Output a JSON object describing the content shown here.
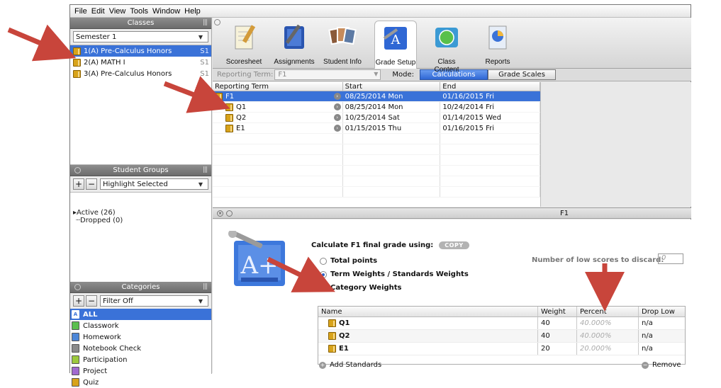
{
  "menu": [
    "File",
    "Edit",
    "View",
    "Tools",
    "Window",
    "Help"
  ],
  "classes": {
    "header": "Classes",
    "semester": "Semester 1",
    "items": [
      {
        "name": "1(A) Pre-Calculus Honors",
        "tail": "S1",
        "selected": true
      },
      {
        "name": "2(A) MATH I",
        "tail": "S1",
        "selected": false
      },
      {
        "name": "3(A) Pre-Calculus Honors",
        "tail": "S1",
        "selected": false
      }
    ]
  },
  "student_groups": {
    "header": "Student Groups",
    "filter": "Highlight Selected",
    "tree": [
      "Active (26)",
      "Dropped (0)"
    ]
  },
  "categories": {
    "header": "Categories",
    "filter": "Filter Off",
    "items": [
      {
        "name": "ALL",
        "color": "#3a72d8",
        "selected": true
      },
      {
        "name": "Classwork",
        "color": "#5bbf4d"
      },
      {
        "name": "Homework",
        "color": "#4c86d8"
      },
      {
        "name": "Notebook Check",
        "color": "#8a8a8a"
      },
      {
        "name": "Participation",
        "color": "#9cc93d"
      },
      {
        "name": "Project",
        "color": "#a06ad0"
      },
      {
        "name": "Quiz",
        "color": "#d8a31a"
      }
    ]
  },
  "toolbar": {
    "items": [
      "Scoresheet",
      "Assignments",
      "Student Info",
      "Grade Setup",
      "Class Content",
      "Reports"
    ],
    "active": "Grade Setup"
  },
  "subbar": {
    "term_label": "Reporting Term:",
    "term_value": "F1",
    "mode_label": "Mode:",
    "mode_on": "Calculations",
    "mode_off": "Grade Scales"
  },
  "terms": {
    "headers": [
      "Reporting Term",
      "Start",
      "End"
    ],
    "rows": [
      {
        "term": "F1",
        "start": "08/25/2014 Mon",
        "end": "01/16/2015 Fri",
        "selected": true,
        "indent": 0
      },
      {
        "term": "Q1",
        "start": "08/25/2014 Mon",
        "end": "10/24/2014 Fri",
        "indent": 1
      },
      {
        "term": "Q2",
        "start": "10/25/2014 Sat",
        "end": "01/14/2015 Wed",
        "indent": 1
      },
      {
        "term": "E1",
        "start": "01/15/2015 Thu",
        "end": "01/16/2015 Fri",
        "indent": 1
      }
    ]
  },
  "detail": {
    "title": "F1",
    "calc_text": "Calculate F1 final grade using:",
    "copy": "COPY",
    "options": [
      "Total points",
      "Term Weights / Standards Weights",
      "Category Weights"
    ],
    "selected_option": 1,
    "low_scores_label": "Number of low scores to discard:",
    "low_scores_placeholder": "0",
    "table_headers": [
      "Name",
      "Weight",
      "Percent",
      "Drop Low"
    ],
    "rows": [
      {
        "name": "Q1",
        "weight": "40",
        "percent": "40.000%",
        "drop": "n/a"
      },
      {
        "name": "Q2",
        "weight": "40",
        "percent": "40.000%",
        "drop": "n/a"
      },
      {
        "name": "E1",
        "weight": "20",
        "percent": "20.000%",
        "drop": "n/a"
      }
    ],
    "add_standards": "Add Standards",
    "remove": "Remove"
  },
  "annotation_color": "#c8453b"
}
